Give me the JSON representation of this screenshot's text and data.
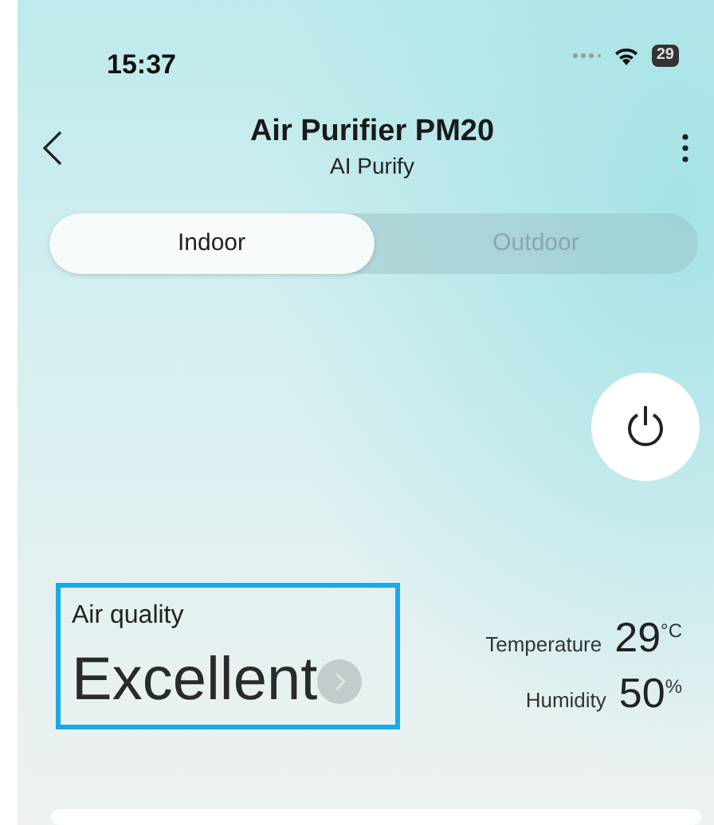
{
  "status_bar": {
    "time": "15:37",
    "battery": "29"
  },
  "header": {
    "title": "Air Purifier PM20",
    "subtitle": "AI Purify"
  },
  "tabs": [
    {
      "label": "Indoor",
      "selected": true
    },
    {
      "label": "Outdoor",
      "selected": false
    }
  ],
  "power": {
    "on": false
  },
  "air_quality": {
    "label": "Air quality",
    "value": "Excellent",
    "highlighted": true
  },
  "readings": [
    {
      "label": "Temperature",
      "value": "29",
      "unit": "°C"
    },
    {
      "label": "Humidity",
      "value": "50",
      "unit": "%"
    }
  ]
}
